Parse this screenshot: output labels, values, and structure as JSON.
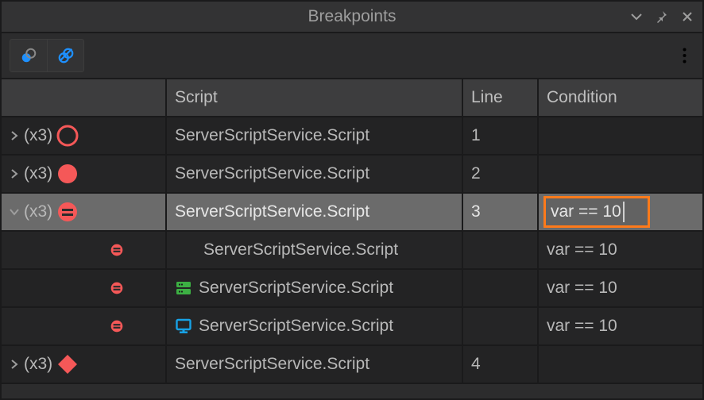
{
  "title": "Breakpoints",
  "columns": {
    "script": "Script",
    "line": "Line",
    "condition": "Condition"
  },
  "rows": [
    {
      "kind": "group",
      "expanded": false,
      "count": "(x3)",
      "bp_type": "circle-outline",
      "script": "ServerScriptService.Script",
      "line": "1",
      "condition": "",
      "selected": false
    },
    {
      "kind": "group",
      "expanded": false,
      "count": "(x3)",
      "bp_type": "circle-solid",
      "script": "ServerScriptService.Script",
      "line": "2",
      "condition": "",
      "selected": false
    },
    {
      "kind": "group",
      "expanded": true,
      "count": "(x3)",
      "bp_type": "equals",
      "script": "ServerScriptService.Script",
      "line": "3",
      "condition": "var == 10",
      "condition_editing": true,
      "selected": true
    },
    {
      "kind": "child",
      "bp_type": "equals",
      "context_icon": "none",
      "script": "ServerScriptService.Script",
      "line": "",
      "condition": "var == 10"
    },
    {
      "kind": "child",
      "bp_type": "equals",
      "context_icon": "server",
      "script": "ServerScriptService.Script",
      "line": "",
      "condition": "var == 10"
    },
    {
      "kind": "child",
      "bp_type": "equals",
      "context_icon": "client",
      "script": "ServerScriptService.Script",
      "line": "",
      "condition": "var == 10"
    },
    {
      "kind": "group",
      "expanded": false,
      "count": "(x3)",
      "bp_type": "diamond",
      "script": "ServerScriptService.Script",
      "line": "4",
      "condition": "",
      "selected": false
    }
  ],
  "colors": {
    "red": "#f55858",
    "orange_highlight": "#ff7a1a",
    "server_icon": "#3cb043",
    "client_icon": "#17a2e6"
  }
}
